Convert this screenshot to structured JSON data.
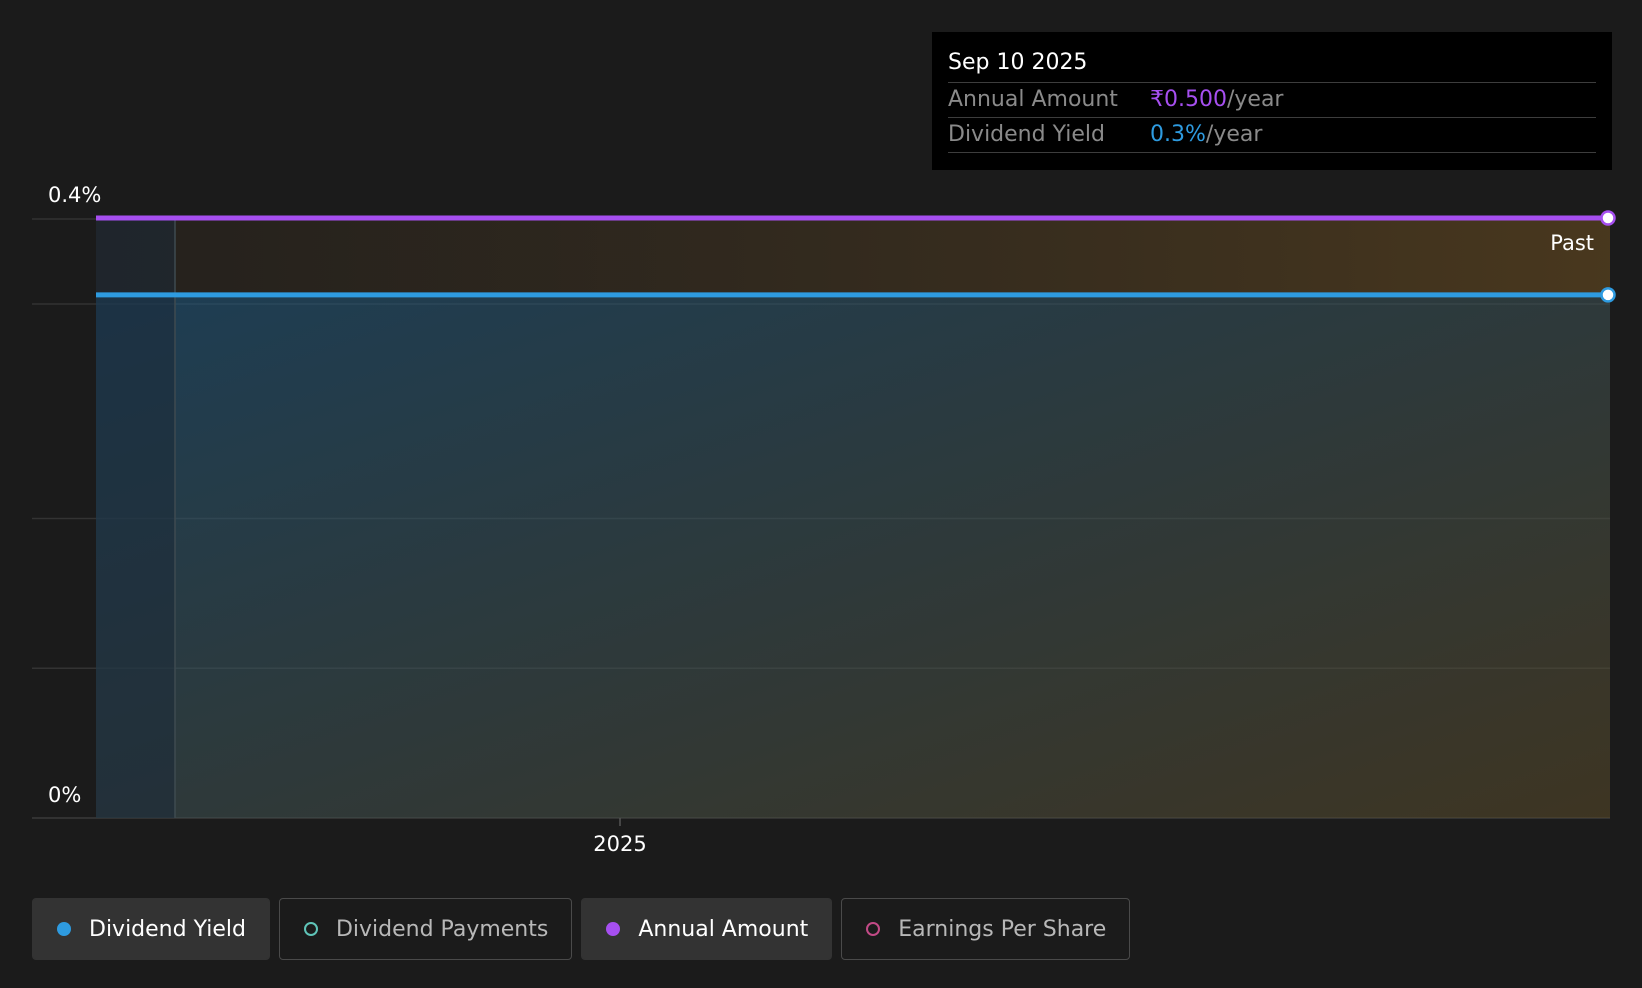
{
  "chart_data": {
    "type": "area",
    "y_tick_labels": [
      "0%",
      "0.4%"
    ],
    "ylim": [
      0,
      0.4
    ],
    "x_tick_labels": [
      "2025"
    ],
    "region_label": "Past",
    "grid": true,
    "series": [
      {
        "name": "Annual Amount",
        "color": "#a64ff0",
        "unit": "₹/year",
        "values": [
          0.5,
          0.5
        ]
      },
      {
        "name": "Dividend Yield",
        "color": "#2e9be0",
        "unit": "%",
        "values": [
          0.35,
          0.35
        ]
      }
    ],
    "x": [
      "2024-08",
      "2025-09-10"
    ]
  },
  "tooltip": {
    "date": "Sep 10 2025",
    "rows": [
      {
        "label": "Annual Amount",
        "value": "₹0.500",
        "unit": "/year",
        "color": "#a64ff0"
      },
      {
        "label": "Dividend Yield",
        "value": "0.3%",
        "unit": "/year",
        "color": "#2e9be0"
      }
    ]
  },
  "legend": [
    {
      "label": "Dividend Yield",
      "color": "#2e9be0",
      "active": true,
      "filled": true
    },
    {
      "label": "Dividend Payments",
      "color": "#5fc4b8",
      "active": false,
      "filled": false
    },
    {
      "label": "Annual Amount",
      "color": "#a64ff0",
      "active": true,
      "filled": true
    },
    {
      "label": "Earnings Per Share",
      "color": "#c24a86",
      "active": false,
      "filled": false
    }
  ]
}
